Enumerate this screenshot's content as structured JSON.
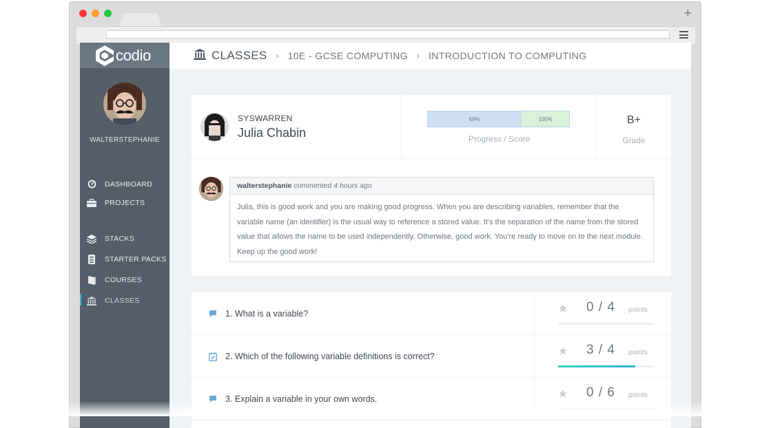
{
  "brand": {
    "name": "codio"
  },
  "sidebar": {
    "username": "WALTERSTEPHANIE",
    "items": [
      {
        "label": "DASHBOARD",
        "icon": "dashboard-icon"
      },
      {
        "label": "PROJECTS",
        "icon": "briefcase-icon"
      },
      {
        "label": "STACKS",
        "icon": "stacks-icon"
      },
      {
        "label": "STARTER PACKS",
        "icon": "starter-packs-icon"
      },
      {
        "label": "COURSES",
        "icon": "courses-icon"
      },
      {
        "label": "CLASSES",
        "icon": "classes-icon",
        "active": true
      }
    ]
  },
  "breadcrumb": {
    "root": "CLASSES",
    "items": [
      "10E - GCSE COMPUTING",
      "INTRODUCTION TO COMPUTING"
    ]
  },
  "student": {
    "username": "SYSWARREN",
    "name": "Julia Chabin",
    "progress_pct": 66,
    "progress_label": "66%",
    "score_label": "100%",
    "progress_score_caption": "Progress / Score",
    "grade": "B+",
    "grade_caption": "Grade"
  },
  "comment": {
    "author": "walterstephanie",
    "verb": "commented",
    "time": "4 hours ago",
    "text": "Julia, this is good work and you are making good progress. When you are describing variables, remember that the variable name (an identifier) is the usual way to reference a stored value. It's the separation of the name from the stored value that allows the name to be used independently. Otherwise, good work. You're ready to move on to the next module. Keep up the good work!"
  },
  "questions": [
    {
      "title": "1. What is a variable?",
      "icon": "comment-icon",
      "score": "0 / 4",
      "points_label": "points",
      "fill": 0
    },
    {
      "title": "2. Which of the following variable definitions is correct?",
      "icon": "checklist-icon",
      "score": "3 / 4",
      "points_label": "points",
      "fill": 0.8
    },
    {
      "title": "3. Explain a variable in your own words.",
      "icon": "comment-icon",
      "score": "0 / 6",
      "points_label": "points",
      "fill": 0
    }
  ],
  "colors": {
    "accent": "#2fb7d6",
    "sidebar": "#545e68",
    "progress": "#cde1f3",
    "score": "#d8f2dc"
  }
}
